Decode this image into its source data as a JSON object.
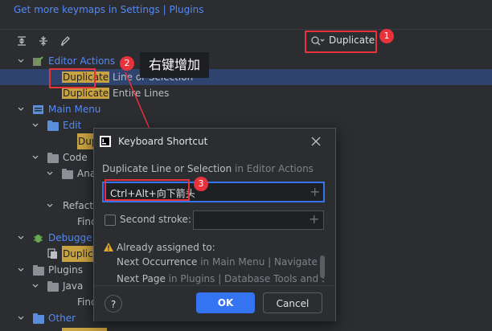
{
  "top_link": "Get more keymaps in Settings | Plugins",
  "search": {
    "value": "Duplicate"
  },
  "annotations": {
    "badge1": "1",
    "badge2": "2",
    "badge3": "3",
    "tooltip": "右键增加"
  },
  "tree": {
    "editor_actions": "Editor Actions",
    "dup_line_hl": "Duplicate",
    "dup_line_rest": " Line or Selection",
    "dup_entire_hl": "Duplicate",
    "dup_entire_rest": " Entire Lines",
    "main_menu": "Main Menu",
    "edit": "Edit",
    "edit_child_hl": "Dup",
    "code": "Code",
    "code_child": "Ana",
    "refactor": "Refacto",
    "find1": "Find",
    "debugger": "Debugge",
    "debugger_child_hl": "Duplic",
    "plugins": "Plugins",
    "java": "Java",
    "find2": "Find",
    "other": "Other"
  },
  "dialog": {
    "title": "Keyboard Shortcut",
    "action_name": "Duplicate Line or Selection",
    "action_context": " in Editor Actions",
    "shortcut_value": "Ctrl+Alt+向下箭头",
    "second_stroke_label": "Second stroke:",
    "already_assigned": "Already assigned to:",
    "conflicts": [
      {
        "name": "Next Occurrence",
        "context": " in Main Menu | Navigate"
      },
      {
        "name": "Next Page",
        "context": " in Plugins | Database Tools and S"
      }
    ],
    "help_label": "?",
    "ok_label": "OK",
    "cancel_label": "Cancel"
  }
}
